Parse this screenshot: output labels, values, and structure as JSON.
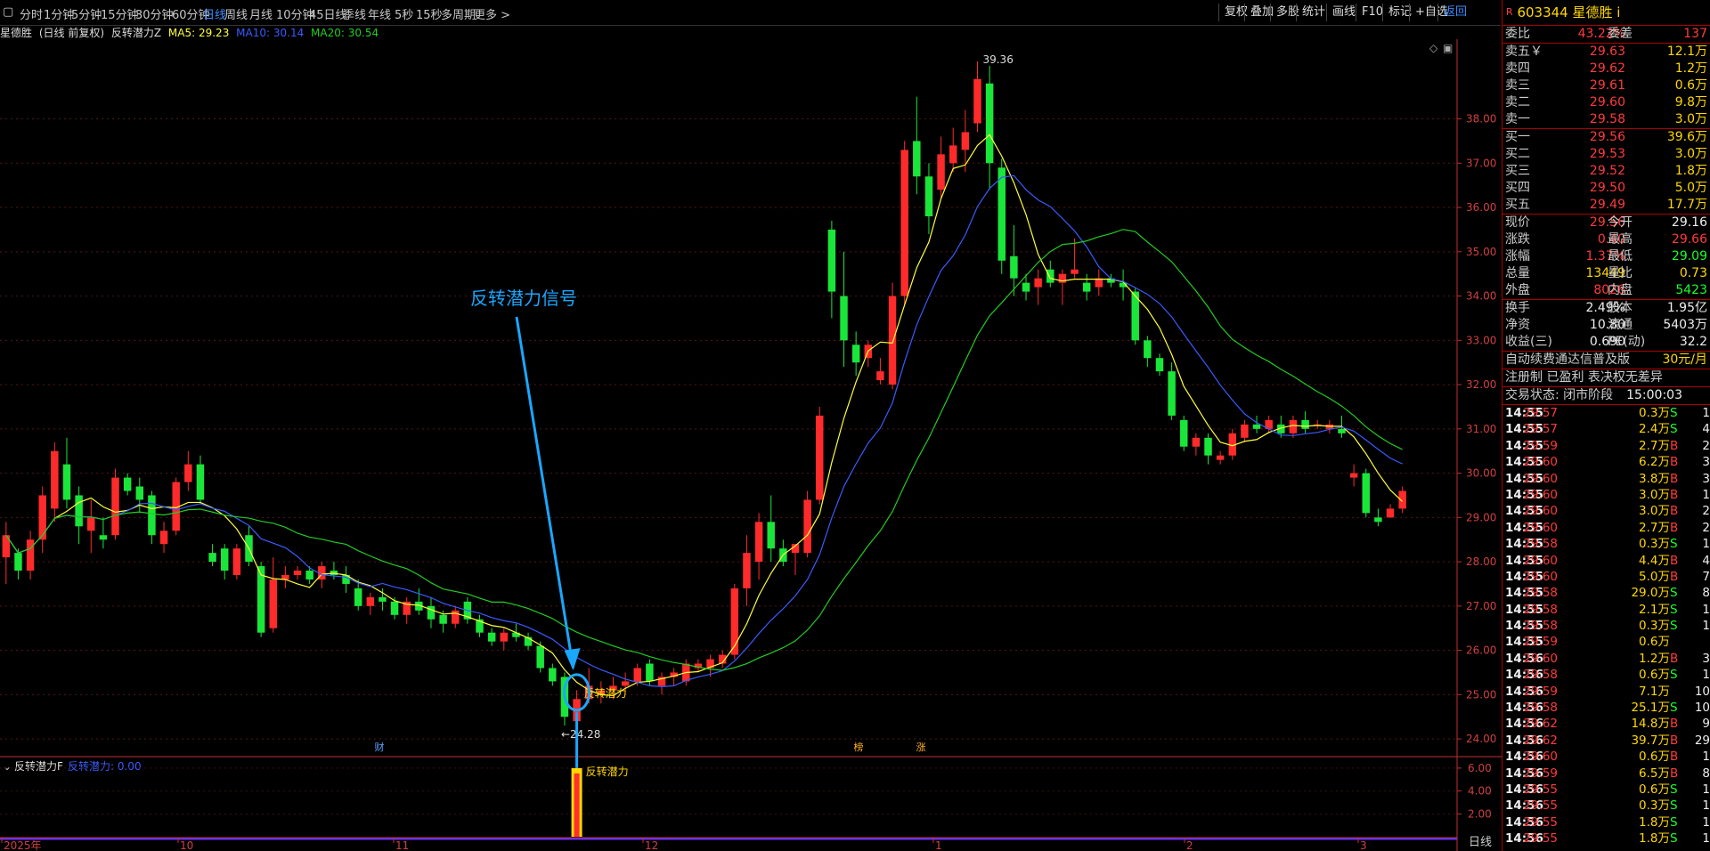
{
  "toolbar": {
    "periods": [
      "分时",
      "1分钟",
      "5分钟",
      "15分钟",
      "30分钟",
      "60分钟",
      "日线",
      "周线",
      "月线",
      "10分钟",
      "45日线",
      "季线",
      "年线",
      "5秒",
      "15秒",
      "多周期",
      "更多 >"
    ],
    "active_period": "日线",
    "right_buttons": [
      "复权",
      "叠加",
      "多股",
      "统计",
      "画线",
      "F10",
      "标记",
      "+自选",
      "返回"
    ],
    "active_right": "返回"
  },
  "info": {
    "stock": "星德胜",
    "mode": "(日线 前复权)",
    "indicator": "反转潜力Z",
    "ma5": "MA5: 29.23",
    "ma10": "MA10: 30.14",
    "ma20": "MA20: 30.54"
  },
  "sub_info": {
    "indicator": "反转潜力F",
    "value": "反转潜力: 0.00"
  },
  "colors": {
    "up": "#ff2b2b",
    "down": "#1ae63a",
    "ma5": "#ffff3a",
    "ma10": "#3a5bff",
    "ma20": "#22cc22",
    "annotation": "#1aa7ff",
    "axis": "#c03030"
  },
  "chart_data": {
    "type": "candlestick",
    "ylim": [
      23.6,
      39.8
    ],
    "y_ticks": [
      "38.00",
      "37.00",
      "36.00",
      "35.00",
      "34.00",
      "33.00",
      "32.00",
      "31.00",
      "30.00",
      "29.00",
      "28.00",
      "27.00",
      "26.00",
      "25.00",
      "24.00"
    ],
    "x_labels": [
      "2025年",
      "10",
      "11",
      "12",
      "1",
      "2",
      "3"
    ],
    "candles": [
      [
        28.1,
        28.9,
        27.5,
        28.6
      ],
      [
        28.2,
        28.3,
        27.6,
        27.8
      ],
      [
        27.8,
        28.7,
        27.6,
        28.5
      ],
      [
        28.5,
        29.7,
        28.2,
        29.5
      ],
      [
        29.2,
        30.7,
        28.9,
        30.5
      ],
      [
        30.2,
        30.8,
        29.2,
        29.4
      ],
      [
        29.5,
        29.7,
        28.4,
        28.8
      ],
      [
        28.7,
        29.4,
        28.2,
        29.0
      ],
      [
        28.6,
        29.0,
        28.3,
        28.5
      ],
      [
        28.6,
        30.1,
        28.5,
        29.9
      ],
      [
        29.9,
        30.0,
        29.5,
        29.6
      ],
      [
        29.7,
        29.9,
        29.1,
        29.4
      ],
      [
        29.5,
        29.6,
        28.4,
        28.6
      ],
      [
        28.4,
        28.9,
        28.2,
        28.7
      ],
      [
        28.7,
        29.9,
        28.6,
        29.8
      ],
      [
        29.8,
        30.5,
        29.6,
        30.2
      ],
      [
        30.2,
        30.4,
        29.3,
        29.4
      ],
      [
        28.2,
        28.4,
        27.9,
        28.0
      ],
      [
        28.3,
        28.4,
        27.6,
        27.8
      ],
      [
        27.7,
        28.4,
        27.6,
        28.3
      ],
      [
        28.6,
        28.8,
        27.9,
        28.0
      ],
      [
        27.9,
        28.0,
        26.3,
        26.4
      ],
      [
        26.5,
        28.1,
        26.4,
        27.6
      ],
      [
        27.6,
        27.9,
        27.4,
        27.7
      ],
      [
        27.7,
        27.9,
        27.6,
        27.8
      ],
      [
        27.8,
        27.9,
        27.5,
        27.6
      ],
      [
        27.6,
        28.0,
        27.4,
        27.9
      ],
      [
        27.8,
        28.0,
        27.6,
        27.7
      ],
      [
        27.7,
        27.9,
        27.3,
        27.5
      ],
      [
        27.4,
        27.6,
        26.9,
        27.0
      ],
      [
        27.0,
        27.3,
        26.8,
        27.2
      ],
      [
        27.2,
        27.4,
        26.9,
        27.1
      ],
      [
        27.1,
        27.2,
        26.7,
        26.8
      ],
      [
        26.8,
        27.2,
        26.6,
        27.1
      ],
      [
        27.1,
        27.4,
        26.8,
        26.9
      ],
      [
        27.0,
        27.2,
        26.5,
        26.7
      ],
      [
        26.8,
        26.9,
        26.4,
        26.6
      ],
      [
        26.6,
        27.0,
        26.5,
        26.9
      ],
      [
        27.1,
        27.2,
        26.6,
        26.7
      ],
      [
        26.7,
        26.8,
        26.3,
        26.4
      ],
      [
        26.4,
        26.5,
        26.1,
        26.2
      ],
      [
        26.2,
        26.5,
        26.0,
        26.4
      ],
      [
        26.4,
        26.6,
        26.2,
        26.3
      ],
      [
        26.3,
        26.4,
        26.0,
        26.1
      ],
      [
        26.1,
        26.2,
        25.5,
        25.6
      ],
      [
        25.6,
        25.7,
        25.2,
        25.3
      ],
      [
        25.4,
        25.5,
        24.3,
        24.5
      ],
      [
        24.4,
        25.1,
        24.3,
        24.9
      ],
      [
        24.9,
        25.6,
        24.8,
        25.2
      ],
      [
        25.0,
        25.3,
        24.8,
        25.1
      ],
      [
        25.1,
        25.4,
        24.9,
        25.2
      ],
      [
        25.2,
        25.5,
        25.0,
        25.3
      ],
      [
        25.3,
        25.7,
        25.2,
        25.6
      ],
      [
        25.7,
        25.8,
        25.2,
        25.3
      ],
      [
        25.2,
        25.5,
        25.0,
        25.4
      ],
      [
        25.4,
        25.6,
        25.2,
        25.5
      ],
      [
        25.3,
        25.8,
        25.2,
        25.7
      ],
      [
        25.6,
        25.8,
        25.5,
        25.7
      ],
      [
        25.6,
        25.9,
        25.4,
        25.8
      ],
      [
        25.7,
        26.0,
        25.6,
        25.9
      ],
      [
        25.9,
        27.5,
        25.8,
        27.4
      ],
      [
        27.4,
        28.6,
        27.0,
        28.2
      ],
      [
        28.0,
        29.1,
        27.6,
        28.9
      ],
      [
        28.9,
        29.5,
        28.0,
        28.3
      ],
      [
        28.3,
        28.5,
        27.9,
        28.0
      ],
      [
        28.2,
        28.4,
        27.7,
        28.4
      ],
      [
        28.2,
        29.6,
        28.1,
        29.4
      ],
      [
        29.4,
        31.5,
        29.3,
        31.3
      ],
      [
        35.5,
        35.7,
        33.5,
        34.1
      ],
      [
        34.0,
        35.0,
        32.4,
        33.0
      ],
      [
        32.9,
        33.2,
        32.2,
        32.5
      ],
      [
        32.6,
        33.0,
        32.4,
        32.9
      ],
      [
        32.1,
        32.6,
        32.0,
        32.3
      ],
      [
        32.0,
        34.3,
        31.9,
        34.0
      ],
      [
        34.0,
        37.5,
        33.8,
        37.3
      ],
      [
        37.5,
        38.5,
        36.3,
        36.7
      ],
      [
        36.7,
        37.0,
        35.4,
        35.8
      ],
      [
        36.4,
        37.6,
        36.2,
        37.2
      ],
      [
        37.0,
        37.8,
        36.8,
        37.4
      ],
      [
        37.3,
        38.2,
        36.8,
        37.7
      ],
      [
        37.9,
        39.3,
        37.7,
        38.9
      ],
      [
        38.8,
        39.2,
        36.4,
        37.0
      ],
      [
        36.9,
        37.1,
        34.5,
        34.8
      ],
      [
        34.9,
        35.6,
        34.0,
        34.4
      ],
      [
        34.3,
        34.5,
        33.9,
        34.1
      ],
      [
        34.2,
        34.6,
        33.8,
        34.4
      ],
      [
        34.6,
        34.8,
        34.2,
        34.3
      ],
      [
        34.3,
        34.6,
        33.8,
        34.5
      ],
      [
        34.5,
        35.3,
        34.4,
        34.6
      ],
      [
        34.3,
        34.5,
        33.9,
        34.1
      ],
      [
        34.2,
        34.6,
        34.0,
        34.4
      ],
      [
        34.4,
        34.5,
        34.2,
        34.3
      ],
      [
        34.3,
        34.6,
        33.9,
        34.2
      ],
      [
        34.1,
        34.2,
        32.9,
        33.0
      ],
      [
        33.0,
        33.1,
        32.4,
        32.6
      ],
      [
        32.6,
        32.7,
        32.2,
        32.3
      ],
      [
        32.3,
        32.5,
        31.2,
        31.3
      ],
      [
        31.2,
        31.3,
        30.5,
        30.6
      ],
      [
        30.6,
        30.9,
        30.4,
        30.8
      ],
      [
        30.8,
        30.9,
        30.2,
        30.4
      ],
      [
        30.3,
        30.5,
        30.2,
        30.4
      ],
      [
        30.4,
        31.0,
        30.3,
        30.9
      ],
      [
        30.8,
        31.2,
        30.7,
        31.1
      ],
      [
        31.1,
        31.3,
        30.9,
        31.0
      ],
      [
        31.0,
        31.3,
        30.9,
        31.2
      ],
      [
        31.1,
        31.3,
        30.8,
        30.9
      ],
      [
        30.9,
        31.3,
        30.8,
        31.2
      ],
      [
        31.2,
        31.4,
        30.9,
        31.0
      ],
      [
        31.1,
        31.2,
        31.0,
        31.1
      ],
      [
        31.0,
        31.2,
        30.9,
        31.1
      ],
      [
        31.0,
        31.3,
        30.8,
        30.9
      ],
      [
        29.9,
        30.2,
        29.7,
        30.0
      ],
      [
        30.0,
        30.1,
        29.0,
        29.1
      ],
      [
        29.0,
        29.2,
        28.8,
        28.9
      ],
      [
        29.0,
        29.3,
        29.0,
        29.2
      ],
      [
        29.2,
        29.7,
        29.1,
        29.6
      ]
    ],
    "high_label": "39.36",
    "low_label": "←24.28",
    "signal_label": "反转潜力",
    "annotation_text": "反转潜力信号",
    "event_marks": [
      "财",
      "榜",
      "涨"
    ],
    "sub_y_ticks": [
      "6.00",
      "4.00",
      "2.00"
    ],
    "sub_signal_value": 6.0,
    "sub_signal_label": "反转潜力"
  },
  "right_panel": {
    "header": {
      "badge": "R",
      "code": "603344",
      "name": "星德胜"
    },
    "weibi": {
      "label": "委比",
      "value": "43.22%",
      "label2": "委差",
      "value2": "137"
    },
    "sells": [
      {
        "label": "卖五￥",
        "price": "29.63",
        "vol": "12.1万"
      },
      {
        "label": "卖四",
        "price": "29.62",
        "vol": "1.2万"
      },
      {
        "label": "卖三",
        "price": "29.61",
        "vol": "0.6万"
      },
      {
        "label": "卖二",
        "price": "29.60",
        "vol": "9.8万"
      },
      {
        "label": "卖一",
        "price": "29.58",
        "vol": "3.0万"
      }
    ],
    "buys": [
      {
        "label": "买一",
        "price": "29.56",
        "vol": "39.6万"
      },
      {
        "label": "买二",
        "price": "29.53",
        "vol": "3.0万"
      },
      {
        "label": "买三",
        "price": "29.52",
        "vol": "1.8万"
      },
      {
        "label": "买四",
        "price": "29.50",
        "vol": "5.0万"
      },
      {
        "label": "买五",
        "price": "29.49",
        "vol": "17.7万"
      }
    ],
    "quote": [
      {
        "l1": "现价",
        "v1": "29.56",
        "c1": "red",
        "l2": "今开",
        "v2": "29.16",
        "c2": "white"
      },
      {
        "l1": "涨跌",
        "v1": "0.40",
        "c1": "red",
        "l2": "最高",
        "v2": "29.66",
        "c2": "red"
      },
      {
        "l1": "涨幅",
        "v1": "1.37%",
        "c1": "red",
        "l2": "最低",
        "v2": "29.09",
        "c2": "green"
      },
      {
        "l1": "总量",
        "v1": "13449",
        "c1": "yellow",
        "l2": "量比",
        "v2": "0.73",
        "c2": "yellow"
      },
      {
        "l1": "外盘",
        "v1": "8026",
        "c1": "red",
        "l2": "内盘",
        "v2": "5423",
        "c2": "green"
      }
    ],
    "quote2": [
      {
        "l1": "换手",
        "v1": "2.49%",
        "c1": "white",
        "l2": "股本",
        "v2": "1.95亿",
        "c2": "white"
      },
      {
        "l1": "净资",
        "v1": "10.80",
        "c1": "white",
        "l2": "流通",
        "v2": "5403万",
        "c2": "white"
      },
      {
        "l1": "收益(三)",
        "v1": "0.690",
        "c1": "white",
        "l2": "PE(动)",
        "v2": "32.2",
        "c2": "white"
      }
    ],
    "promo": {
      "text": "自动续费通达信普及版",
      "price": "30元/月"
    },
    "reg": "注册制 已盈利 表决权无差异",
    "status": {
      "label": "交易状态: 闭市阶段",
      "time": "15:00:03"
    },
    "ticks": [
      [
        "14:55",
        "29.57",
        "0.3万",
        "S",
        "1"
      ],
      [
        "14:55",
        "29.57",
        "2.4万",
        "S",
        "4"
      ],
      [
        "14:55",
        "29.59",
        "2.7万",
        "B",
        "2"
      ],
      [
        "14:55",
        "29.60",
        "6.2万",
        "B",
        "3"
      ],
      [
        "14:55",
        "29.60",
        "3.8万",
        "B",
        "3"
      ],
      [
        "14:55",
        "29.60",
        "3.0万",
        "B",
        "1"
      ],
      [
        "14:55",
        "29.60",
        "3.0万",
        "B",
        "2"
      ],
      [
        "14:55",
        "29.60",
        "2.7万",
        "B",
        "2"
      ],
      [
        "14:55",
        "29.58",
        "0.3万",
        "S",
        "1"
      ],
      [
        "14:55",
        "29.60",
        "4.4万",
        "B",
        "4"
      ],
      [
        "14:55",
        "29.60",
        "5.0万",
        "B",
        "7"
      ],
      [
        "14:55",
        "29.58",
        "29.0万",
        "S",
        "8"
      ],
      [
        "14:55",
        "29.58",
        "2.1万",
        "S",
        "1"
      ],
      [
        "14:55",
        "29.58",
        "0.3万",
        "S",
        "1"
      ],
      [
        "14:55",
        "29.59",
        "0.6万",
        "",
        ""
      ],
      [
        "14:56",
        "29.60",
        "1.2万",
        "B",
        "3"
      ],
      [
        "14:56",
        "29.58",
        "0.6万",
        "S",
        "1"
      ],
      [
        "14:56",
        "29.59",
        "7.1万",
        "",
        "10"
      ],
      [
        "14:56",
        "29.58",
        "25.1万",
        "S",
        "10"
      ],
      [
        "14:56",
        "29.62",
        "14.8万",
        "B",
        "9"
      ],
      [
        "14:56",
        "29.62",
        "39.7万",
        "B",
        "29"
      ],
      [
        "14:56",
        "29.60",
        "0.6万",
        "B",
        "1"
      ],
      [
        "14:56",
        "29.59",
        "6.5万",
        "B",
        "8"
      ],
      [
        "14:56",
        "29.55",
        "0.6万",
        "S",
        "1"
      ],
      [
        "14:56",
        "29.55",
        "0.3万",
        "S",
        "1"
      ],
      [
        "14:56",
        "29.55",
        "1.8万",
        "S",
        "1"
      ],
      [
        "14:56",
        "29.55",
        "1.8万",
        "S",
        "1"
      ]
    ]
  },
  "footer": {
    "period_tab": "日线"
  }
}
